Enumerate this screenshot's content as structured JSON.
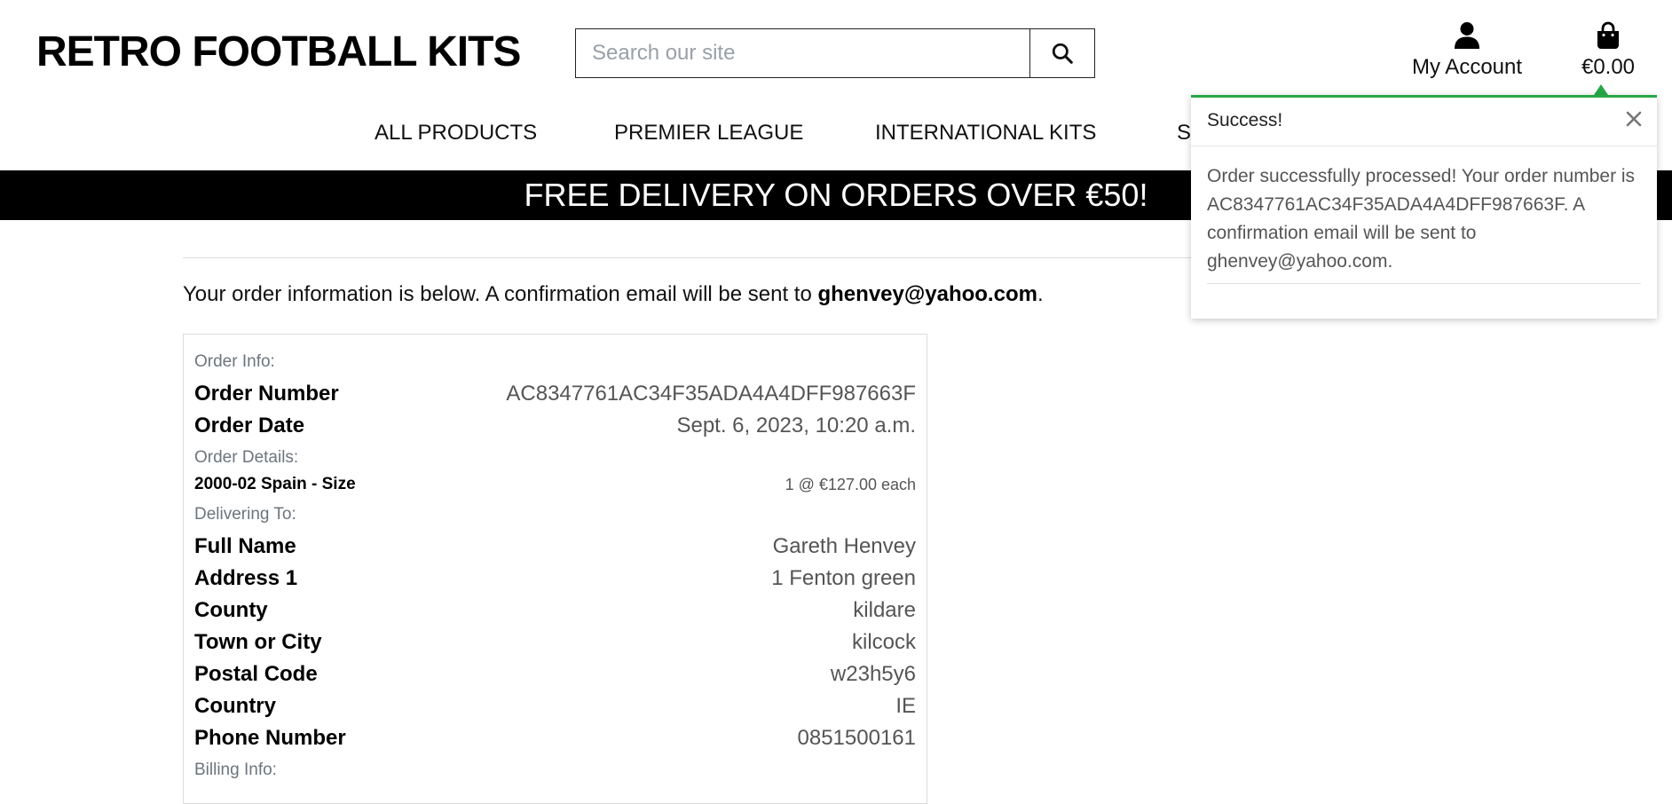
{
  "header": {
    "logo": "RETRO FOOTBALL KITS",
    "search_placeholder": "Search our site",
    "account_label": "My Account",
    "bag_total": "€0.00"
  },
  "nav": {
    "items": [
      "ALL PRODUCTS",
      "PREMIER LEAGUE",
      "INTERNATIONAL KITS",
      "S"
    ]
  },
  "banner": {
    "text": "FREE DELIVERY ON ORDERS OVER €50!"
  },
  "intro": {
    "text": "Your order information is below. A confirmation email will be sent to ",
    "email": "ghenvey@yahoo.com",
    "suffix": "."
  },
  "order": {
    "order_info_heading": "Order Info:",
    "order_number_label": "Order Number",
    "order_number": "AC8347761AC34F35ADA4A4DFF987663F",
    "order_date_label": "Order Date",
    "order_date": "Sept. 6, 2023, 10:20 a.m.",
    "order_details_heading": "Order Details:",
    "items": [
      {
        "name": "2000-02 Spain - Size",
        "qty_price": "1 @ €127.00 each"
      }
    ],
    "delivering_heading": "Delivering To:",
    "delivery": [
      {
        "label": "Full Name",
        "value": "Gareth Henvey"
      },
      {
        "label": "Address 1",
        "value": "1 Fenton green"
      },
      {
        "label": "County",
        "value": "kildare"
      },
      {
        "label": "Town or City",
        "value": "kilcock"
      },
      {
        "label": "Postal Code",
        "value": "w23h5y6"
      },
      {
        "label": "Country",
        "value": "IE"
      },
      {
        "label": "Phone Number",
        "value": "0851500161"
      }
    ],
    "billing_heading": "Billing Info:"
  },
  "toast": {
    "title": "Success!",
    "message": "Order successfully processed! Your order number is AC8347761AC34F35ADA4A4DFF987663F. A confirmation email will be sent to ghenvey@yahoo.com.",
    "accent": "#28a745"
  },
  "icons": {
    "search": "search-icon",
    "account": "user-icon",
    "bag": "shopping-bag-icon",
    "close": "close-icon"
  }
}
